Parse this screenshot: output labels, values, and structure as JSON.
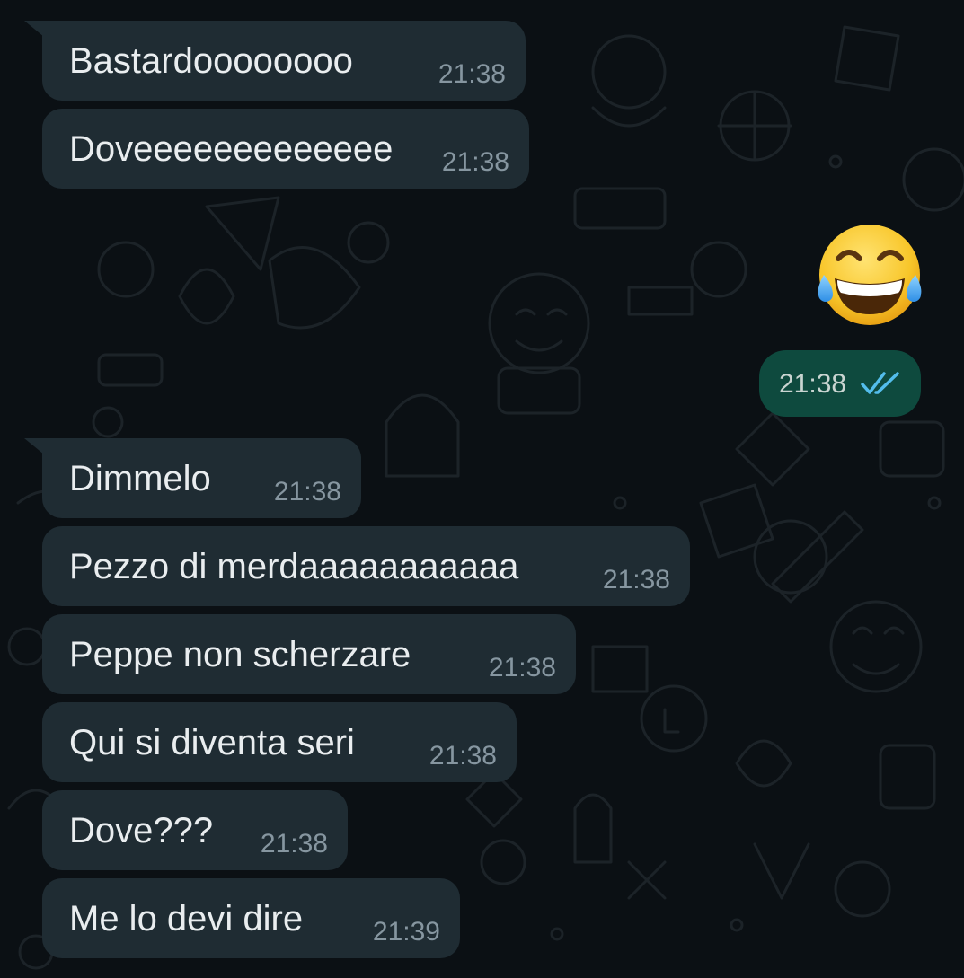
{
  "messages_in_top": [
    {
      "text": "Bastardoooooooo",
      "time": "21:38"
    },
    {
      "text": "Doveeeeeeeeeeeee",
      "time": "21:38"
    }
  ],
  "sent_message": {
    "content": "😂",
    "emoji_name": "face-with-tears-of-joy",
    "time": "21:38",
    "status": "read",
    "status_icon": "double-check-icon",
    "status_color": "#53bdeb"
  },
  "messages_in_bottom": [
    {
      "text": "Dimmelo",
      "time": "21:38"
    },
    {
      "text": "Pezzo di merdaaaaaaaaaaa",
      "time": "21:38"
    },
    {
      "text": "Peppe non scherzare",
      "time": "21:38"
    },
    {
      "text": "Qui si diventa seri",
      "time": "21:38"
    },
    {
      "text": "Dove???",
      "time": "21:38"
    },
    {
      "text": "Me lo devi dire",
      "time": "21:39"
    }
  ],
  "colors": {
    "background": "#0b1014",
    "incoming_bubble": "#1f2c33",
    "outgoing_bubble": "#0e4a3e",
    "text": "#e9edef",
    "timestamp": "#8696a0"
  }
}
